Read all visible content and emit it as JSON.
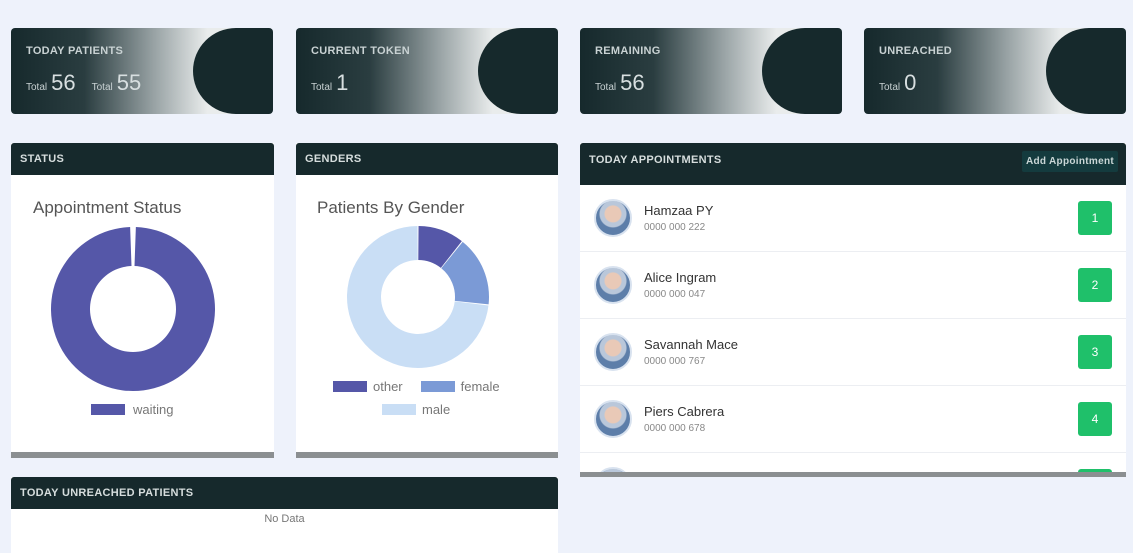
{
  "stats": [
    {
      "title": "TODAY PATIENTS",
      "values": [
        {
          "label": "Total",
          "value": "56"
        },
        {
          "label": "Total",
          "value": "55"
        }
      ]
    },
    {
      "title": "CURRENT TOKEN",
      "values": [
        {
          "label": "Total",
          "value": "1"
        }
      ]
    },
    {
      "title": "REMAINING",
      "values": [
        {
          "label": "Total",
          "value": "56"
        }
      ]
    },
    {
      "title": "UNREACHED",
      "values": [
        {
          "label": "Total",
          "value": "0"
        }
      ]
    }
  ],
  "status_panel": {
    "header": "STATUS",
    "chart_title": "Appointment Status",
    "legend": [
      {
        "label": "waiting",
        "color": "#5557a8"
      }
    ]
  },
  "gender_panel": {
    "header": "GENDERS",
    "chart_title": "Patients By Gender",
    "legend": [
      {
        "label": "other",
        "color": "#5557a8"
      },
      {
        "label": "female",
        "color": "#7b9ad6"
      },
      {
        "label": "male",
        "color": "#c9def5"
      }
    ]
  },
  "appointments": {
    "header": "TODAY APPOINTMENTS",
    "add_label": "Add Appointment",
    "rows": [
      {
        "name": "Hamzaa PY",
        "phone": "0000 000 222",
        "token": "1"
      },
      {
        "name": "Alice Ingram",
        "phone": "0000 000 047",
        "token": "2"
      },
      {
        "name": "Savannah Mace",
        "phone": "0000 000 767",
        "token": "3"
      },
      {
        "name": "Piers Cabrera",
        "phone": "0000 000 678",
        "token": "4"
      }
    ]
  },
  "unreached_panel": {
    "header": "TODAY UNREACHED PATIENTS",
    "empty_text": "No Data"
  },
  "chart_data": [
    {
      "type": "pie",
      "title": "Appointment Status",
      "categories": [
        "waiting"
      ],
      "values": [
        56
      ],
      "colors": [
        "#5557a8"
      ]
    },
    {
      "type": "pie",
      "title": "Patients By Gender",
      "categories": [
        "other",
        "female",
        "male"
      ],
      "values": [
        6,
        9,
        41
      ],
      "colors": [
        "#5557a8",
        "#7b9ad6",
        "#c9def5"
      ]
    }
  ]
}
